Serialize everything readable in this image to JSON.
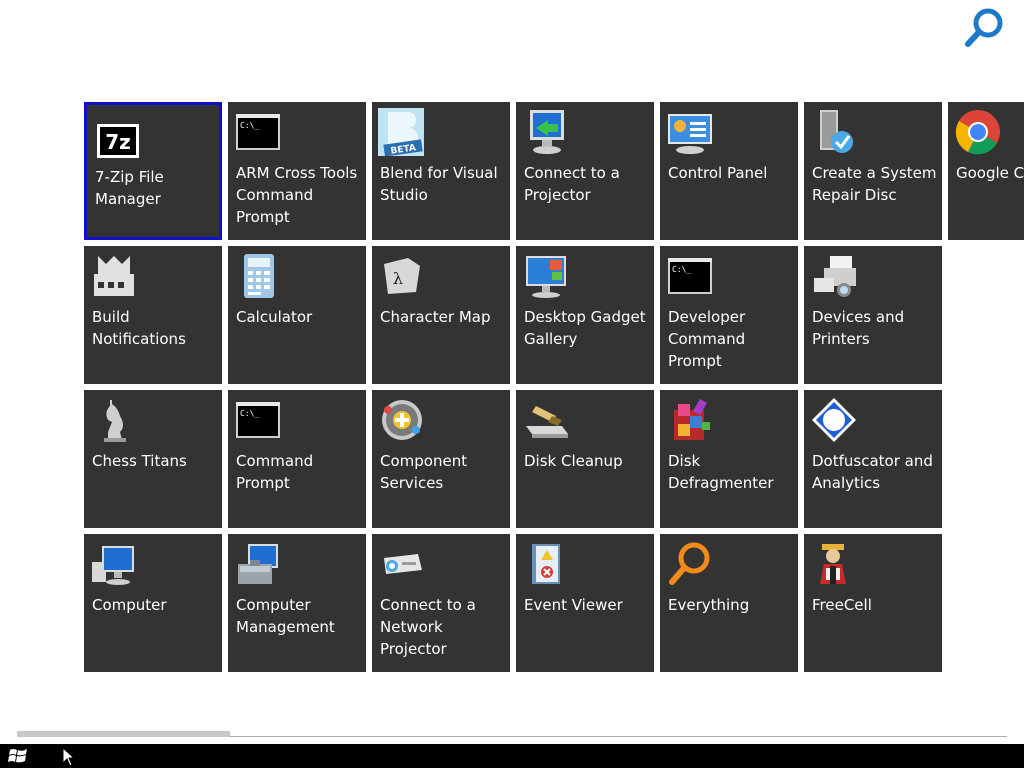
{
  "search": {
    "icon": "search-icon",
    "label": "Search"
  },
  "tiles": [
    {
      "label": "7-Zip File Manager",
      "icon": "7zip-icon"
    },
    {
      "label": "ARM Cross Tools Command Prompt",
      "icon": "console-icon"
    },
    {
      "label": "Blend for Visual Studio",
      "icon": "blend-beta-icon",
      "badge": "BETA"
    },
    {
      "label": "Connect to a Projector",
      "icon": "projector-monitor-icon"
    },
    {
      "label": "Control Panel",
      "icon": "control-panel-icon"
    },
    {
      "label": "Create a System Repair Disc",
      "icon": "repair-disc-icon"
    },
    {
      "label": "Google Ch",
      "icon": "chrome-icon"
    },
    {
      "label": "Build Notifications",
      "icon": "build-notifications-icon"
    },
    {
      "label": "Calculator",
      "icon": "calculator-icon"
    },
    {
      "label": "Character Map",
      "icon": "character-map-icon",
      "glyph": "λ"
    },
    {
      "label": "Desktop Gadget Gallery",
      "icon": "gadget-gallery-icon"
    },
    {
      "label": "Developer Command Prompt",
      "icon": "console-icon"
    },
    {
      "label": "Devices and Printers",
      "icon": "printer-icon"
    },
    {
      "label": "Chess Titans",
      "icon": "chess-icon"
    },
    {
      "label": "Command Prompt",
      "icon": "console-icon"
    },
    {
      "label": "Component Services",
      "icon": "component-services-icon"
    },
    {
      "label": "Disk Cleanup",
      "icon": "disk-cleanup-icon"
    },
    {
      "label": "Disk Defragmenter",
      "icon": "defragmenter-icon"
    },
    {
      "label": "Dotfuscator and Analytics",
      "icon": "dotfuscator-icon"
    },
    {
      "label": "Computer",
      "icon": "computer-icon"
    },
    {
      "label": "Computer Management",
      "icon": "computer-management-icon"
    },
    {
      "label": "Connect to a Network Projector",
      "icon": "network-projector-icon"
    },
    {
      "label": "Event Viewer",
      "icon": "event-viewer-icon"
    },
    {
      "label": "Everything",
      "icon": "everything-icon"
    },
    {
      "label": "FreeCell",
      "icon": "freecell-icon"
    }
  ],
  "console_prompt": "C:\\_",
  "zip_text": "7z",
  "taskbar": {
    "start_icon": "windows-logo-icon"
  },
  "colors": {
    "tile": "#333333",
    "selected_border": "#1010c8",
    "accent": "#1e7ac8"
  }
}
